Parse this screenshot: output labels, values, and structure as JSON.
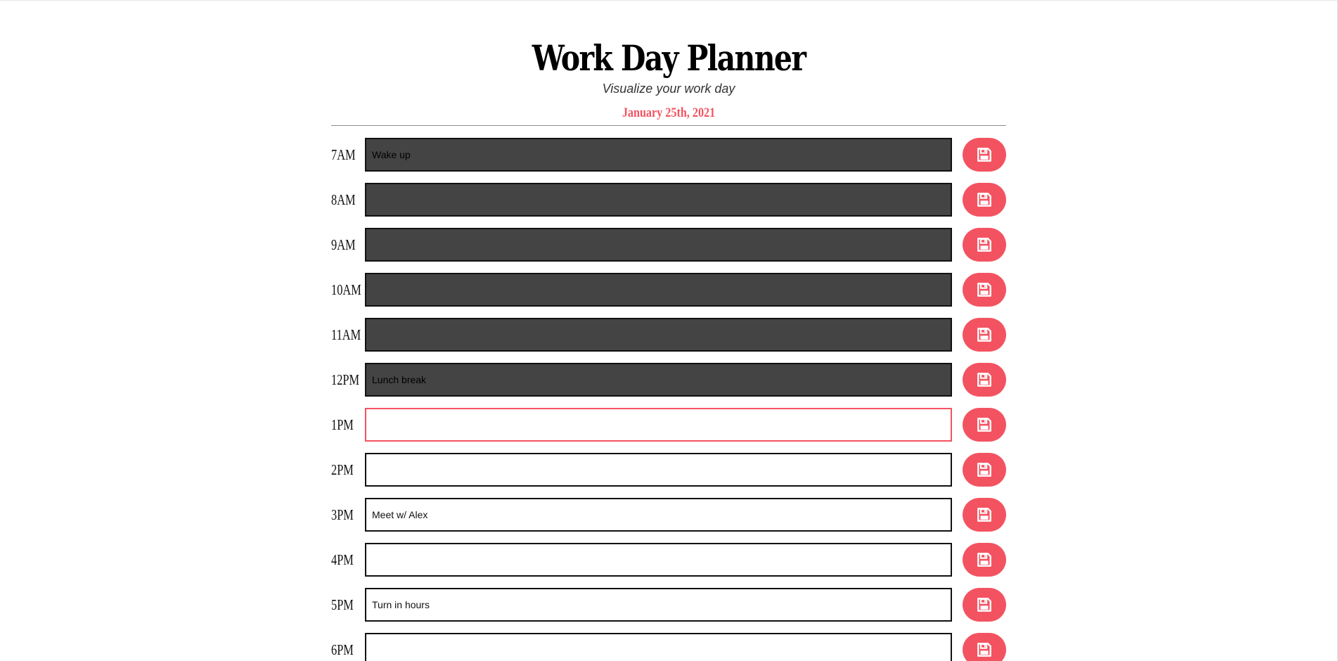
{
  "header": {
    "title": "Work Day Planner",
    "subtitle": "Visualize your work day",
    "date": "January 25th, 2021"
  },
  "rows": [
    {
      "hour": "7AM",
      "text": "Wake up",
      "state": "past"
    },
    {
      "hour": "8AM",
      "text": "",
      "state": "past"
    },
    {
      "hour": "9AM",
      "text": "",
      "state": "past"
    },
    {
      "hour": "10AM",
      "text": "",
      "state": "past"
    },
    {
      "hour": "11AM",
      "text": "",
      "state": "past"
    },
    {
      "hour": "12PM",
      "text": "Lunch break",
      "state": "past"
    },
    {
      "hour": "1PM",
      "text": "",
      "state": "present"
    },
    {
      "hour": "2PM",
      "text": "",
      "state": "future"
    },
    {
      "hour": "3PM",
      "text": "Meet w/ Alex",
      "state": "future"
    },
    {
      "hour": "4PM",
      "text": "",
      "state": "future"
    },
    {
      "hour": "5PM",
      "text": "Turn in hours",
      "state": "future"
    },
    {
      "hour": "6PM",
      "text": "",
      "state": "future"
    }
  ],
  "icons": {
    "save": "save-floppy-icon"
  },
  "colors": {
    "accent": "#f35361",
    "past": "#444444",
    "present_border": "#f35361",
    "future": "#ffffff"
  }
}
